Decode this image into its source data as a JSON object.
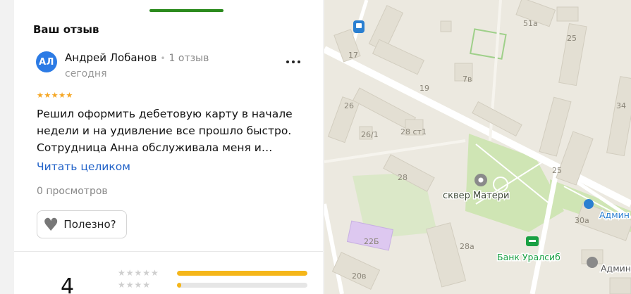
{
  "review": {
    "section_title": "Ваш отзыв",
    "avatar_initials": "АЛ",
    "author_name": "Андрей Лобанов",
    "review_count": "1 отзыв",
    "date": "сегодня",
    "stars": "★★★★★",
    "rating": 5,
    "text": "Решил оформить дебетовую карту в начале недели и на удивление все прошло быстро. Сотрудница Анна обслуживала меня и…",
    "read_more": "Читать целиком",
    "views": "0 просмотров",
    "useful_label": "Полезно?"
  },
  "rating_summary": {
    "average": "4",
    "rows": [
      {
        "stars": "★★★★★",
        "fraction": 1.0
      },
      {
        "stars": "★★★★",
        "fraction": 0.03
      }
    ]
  },
  "map": {
    "labels": {
      "b17": "17",
      "b19": "19",
      "b7v": "7в",
      "b51a": "51а",
      "b25top": "25",
      "b26": "26",
      "b26_1": "26/1",
      "b28st1": "28 ст1",
      "b34": "34",
      "b28": "28",
      "b25mid": "25",
      "b30a": "30а",
      "b22b": "22Б",
      "b28a": "28а",
      "b20v": "20в",
      "park": "сквер Матери",
      "bank": "Банк Уралсиб",
      "admin1": "Админ",
      "admin2": "Админи"
    },
    "colors": {
      "ground": "#ece9e0",
      "building": "#e3dfd3",
      "building_stroke": "#d2cdbf",
      "road": "#ffffff",
      "park": "#cfe5b4",
      "bank_green": "#19a043",
      "admin_blue": "#2a7fd1"
    }
  }
}
